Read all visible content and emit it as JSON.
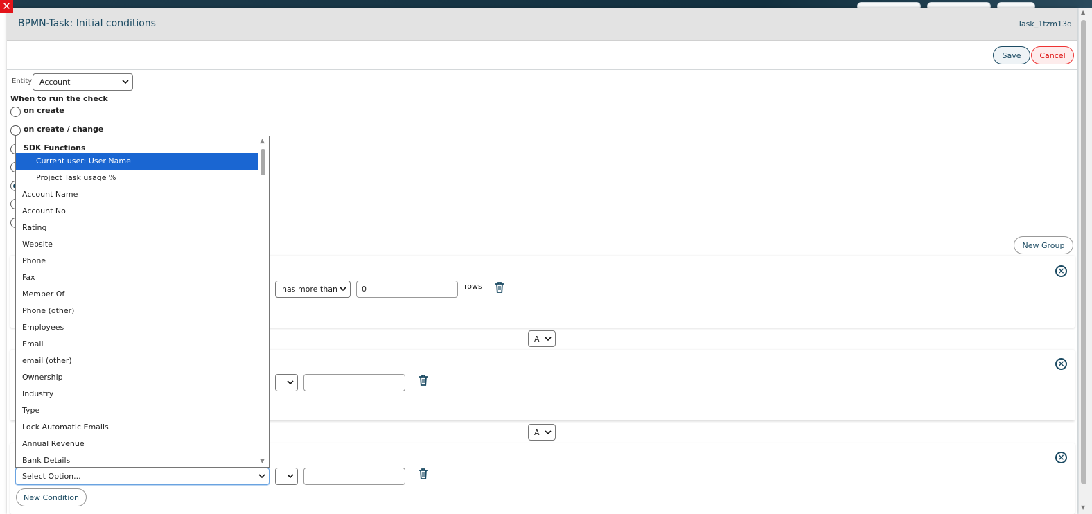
{
  "dialog": {
    "title": "BPMN-Task: Initial conditions",
    "task_id": "Task_1tzm13q"
  },
  "toolbar": {
    "save_label": "Save",
    "cancel_label": "Cancel"
  },
  "entity": {
    "label": "Entity",
    "value": "Account"
  },
  "when": {
    "label": "When to run the check",
    "options": [
      "on create",
      "on create / change"
    ]
  },
  "conditions": {
    "new_group_label": "New Group",
    "group1": {
      "operator": "has more than",
      "value": "0",
      "unit": "rows"
    },
    "connector1": "A",
    "connector2": "A",
    "group3": {
      "field_placeholder": "Select Option..."
    },
    "new_condition_label": "New Condition"
  },
  "dropdown": {
    "group_label": "SDK Functions",
    "sdk_items": [
      "Current user: User Name",
      "Project Task usage %"
    ],
    "selected_item": "Current user: User Name",
    "fields": [
      "Account Name",
      "Account No",
      "Rating",
      "Website",
      "Phone",
      "Fax",
      "Member Of",
      "Phone (other)",
      "Employees",
      "Email",
      "email (other)",
      "Ownership",
      "Industry",
      "Type",
      "Lock Automatic Emails",
      "Annual Revenue",
      "Bank Details"
    ]
  },
  "colors": {
    "accent": "#1c4b63",
    "selected": "#1a66d2",
    "cancel": "#dd1111"
  }
}
